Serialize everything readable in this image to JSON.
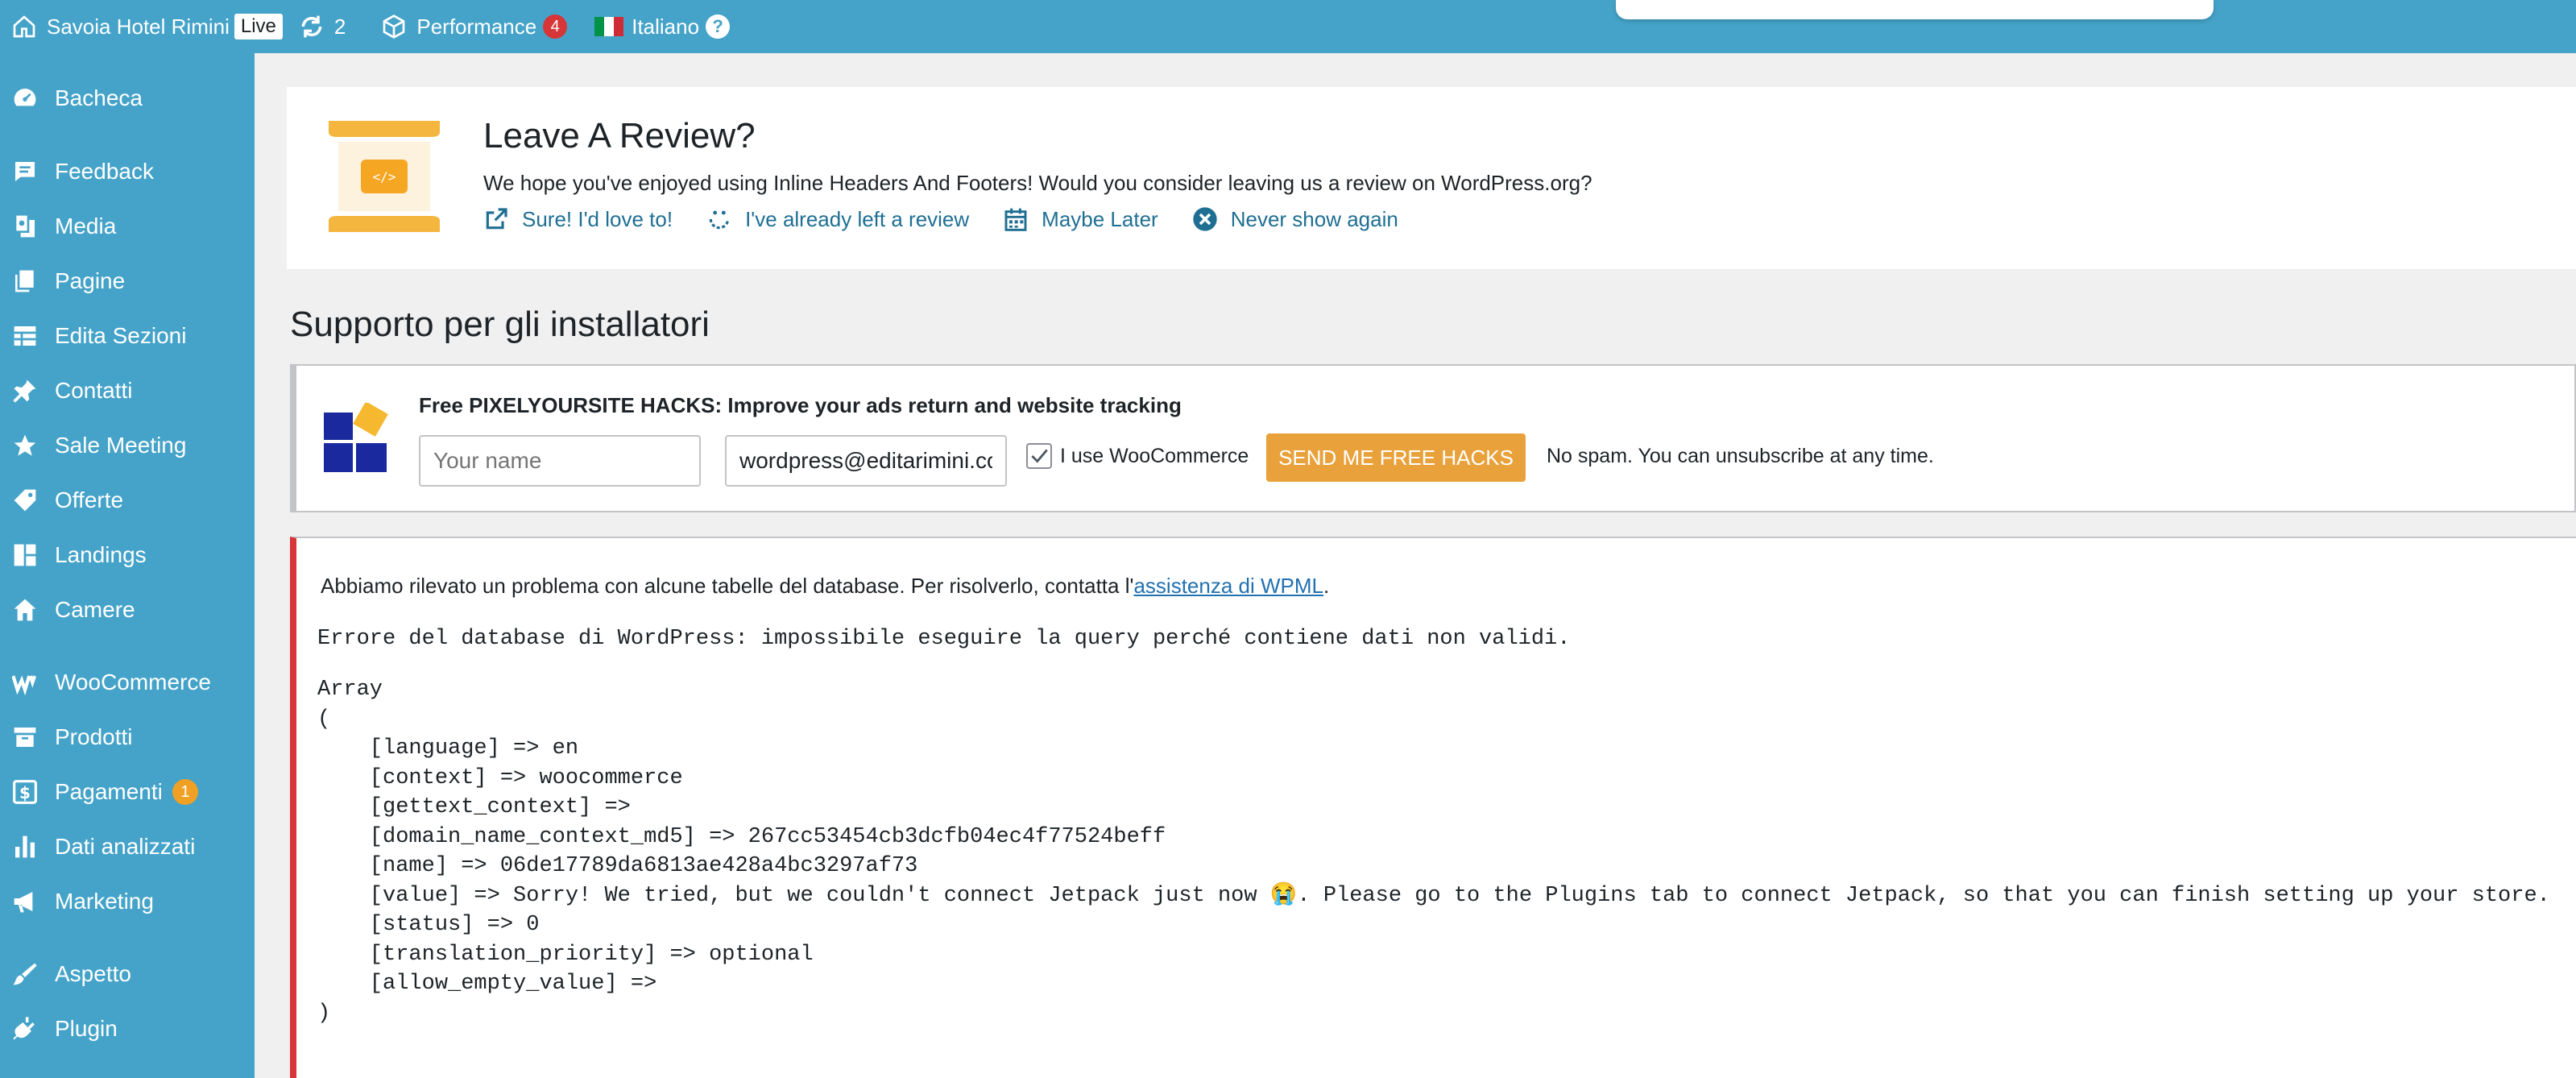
{
  "adminbar": {
    "site_name": "Savoia Hotel Rimini",
    "live_badge": "Live",
    "updates_count": "2",
    "performance_label": "Performance",
    "performance_count": "4",
    "language_label": "Italiano",
    "help_label": "?"
  },
  "sidebar": {
    "items": [
      {
        "label": "Bacheca",
        "icon": "dashboard-icon"
      },
      {
        "label": "Feedback",
        "icon": "feedback-icon"
      },
      {
        "label": "Media",
        "icon": "media-icon"
      },
      {
        "label": "Pagine",
        "icon": "pages-icon"
      },
      {
        "label": "Edita Sezioni",
        "icon": "table-icon"
      },
      {
        "label": "Contatti",
        "icon": "pin-icon"
      },
      {
        "label": "Sale Meeting",
        "icon": "star-icon"
      },
      {
        "label": "Offerte",
        "icon": "tag-icon"
      },
      {
        "label": "Landings",
        "icon": "layout-icon"
      },
      {
        "label": "Camere",
        "icon": "home-icon"
      },
      {
        "label": "WooCommerce",
        "icon": "woo-icon"
      },
      {
        "label": "Prodotti",
        "icon": "archive-icon"
      },
      {
        "label": "Pagamenti",
        "icon": "dollar-icon",
        "badge": "1"
      },
      {
        "label": "Dati analizzati",
        "icon": "chart-bar-icon"
      },
      {
        "label": "Marketing",
        "icon": "megaphone-icon"
      },
      {
        "label": "Aspetto",
        "icon": "brush-icon"
      },
      {
        "label": "Plugin",
        "icon": "plugin-icon"
      }
    ]
  },
  "review": {
    "title": "Leave A Review?",
    "text": "We hope you've enjoyed using Inline Headers And Footers! Would you consider leaving us a review on WordPress.org?",
    "links": {
      "sure": "Sure! I'd love to!",
      "already": "I've already left a review",
      "later": "Maybe Later",
      "never": "Never show again"
    }
  },
  "section_title": "Supporto per gli installatori",
  "pys": {
    "headline": "Free PIXELYOURSITE HACKS: Improve your ads return and website tracking",
    "name_placeholder": "Your name",
    "email_value": "wordpress@editarimini.com",
    "checkbox_label": "I use WooCommerce",
    "button_label": "SEND ME FREE HACKS",
    "nospam": "No spam. You can unsubscribe at any time."
  },
  "error": {
    "notice_prefix": "Abbiamo rilevato un problema con alcune tabelle del database. Per risolverlo, contatta l'",
    "notice_link": "assistenza di WPML",
    "notice_suffix": ".",
    "title": "Errore del database di WordPress: impossibile eseguire la query perché contiene dati non validi.",
    "array_dump": "Array\n(\n    [language] => en\n    [context] => woocommerce\n    [gettext_context] =>\n    [domain_name_context_md5] => 267cc53454cb3dcfb04ec4f77524beff\n    [name] => 06de17789da6813ae428a4bc3297af73\n    [value] => Sorry! We tried, but we couldn't connect Jetpack just now 😭. Please go to the Plugins tab to connect Jetpack, so that you can finish setting up your store.\n    [status] => 0\n    [translation_priority] => optional\n    [allow_empty_value] =>\n)"
  },
  "colors": {
    "sidebar": "#45a3c9",
    "adminbar": "#45a3c9",
    "error_border": "#d63638",
    "button": "#e9a23b",
    "link": "#1f6f93"
  }
}
